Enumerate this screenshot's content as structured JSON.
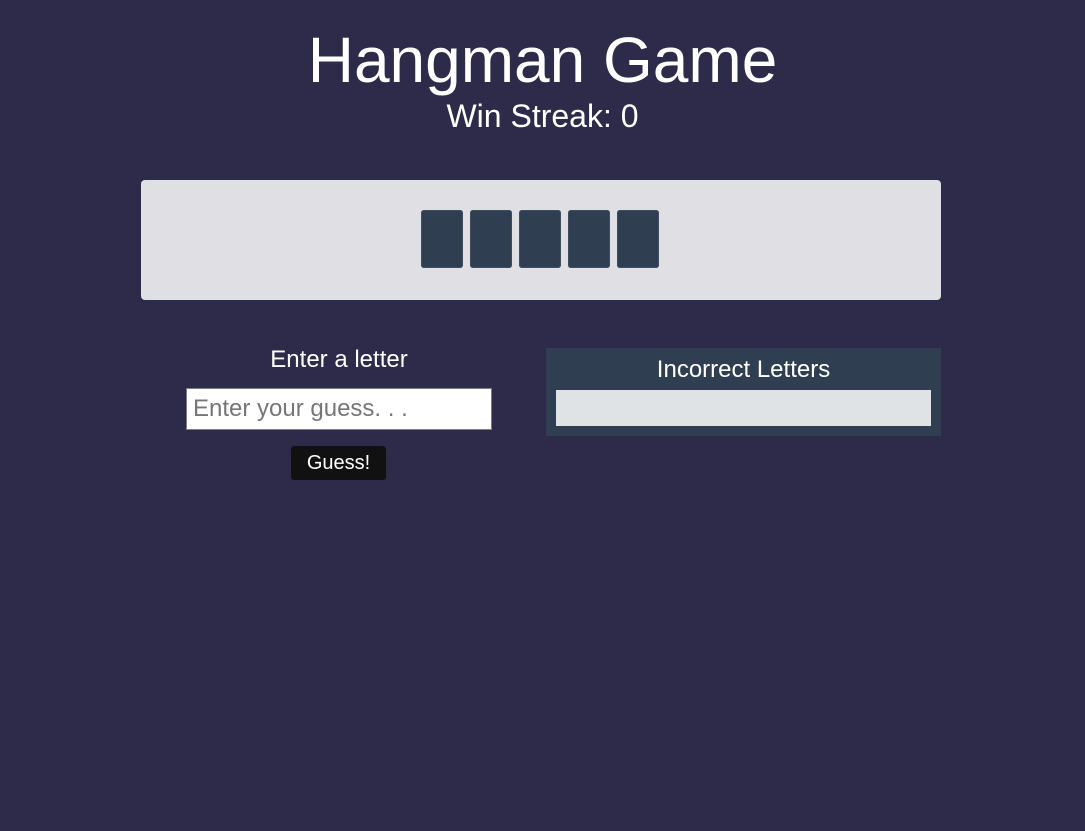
{
  "header": {
    "title": "Hangman Game",
    "win_streak": "Win Streak: 0"
  },
  "word": {
    "slots": [
      "",
      "",
      "",
      "",
      ""
    ]
  },
  "guess": {
    "label": "Enter a letter",
    "placeholder": "Enter your guess. . .",
    "value": "",
    "button_label": "Guess!"
  },
  "incorrect": {
    "title": "Incorrect Letters",
    "letters": ""
  },
  "colors": {
    "background": "#2d2a4a",
    "panel_light": "#e0dfe4",
    "slot": "#2f3e51",
    "button": "#111111"
  }
}
